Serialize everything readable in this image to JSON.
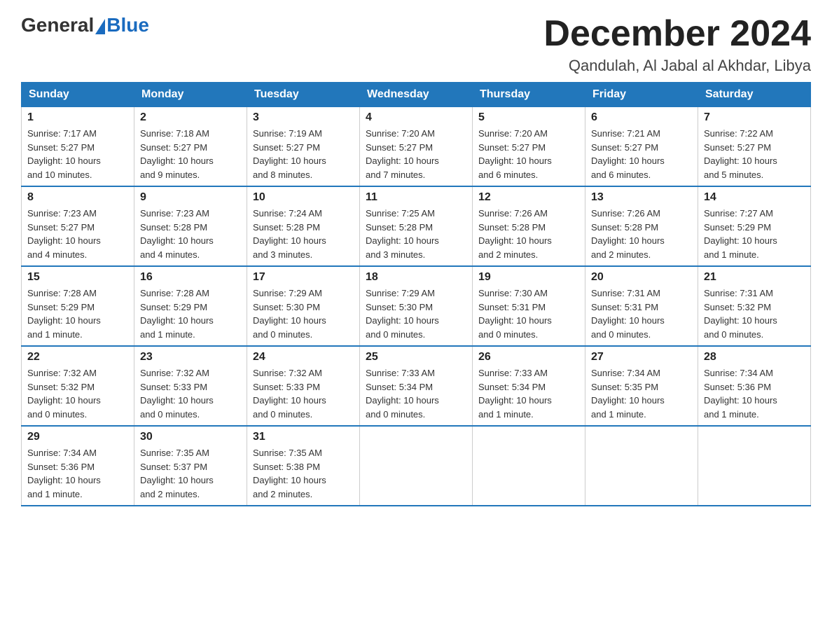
{
  "header": {
    "logo_general": "General",
    "logo_blue": "Blue",
    "month_year": "December 2024",
    "location": "Qandulah, Al Jabal al Akhdar, Libya"
  },
  "weekdays": [
    "Sunday",
    "Monday",
    "Tuesday",
    "Wednesday",
    "Thursday",
    "Friday",
    "Saturday"
  ],
  "weeks": [
    [
      {
        "day": "1",
        "sunrise": "7:17 AM",
        "sunset": "5:27 PM",
        "daylight": "10 hours and 10 minutes."
      },
      {
        "day": "2",
        "sunrise": "7:18 AM",
        "sunset": "5:27 PM",
        "daylight": "10 hours and 9 minutes."
      },
      {
        "day": "3",
        "sunrise": "7:19 AM",
        "sunset": "5:27 PM",
        "daylight": "10 hours and 8 minutes."
      },
      {
        "day": "4",
        "sunrise": "7:20 AM",
        "sunset": "5:27 PM",
        "daylight": "10 hours and 7 minutes."
      },
      {
        "day": "5",
        "sunrise": "7:20 AM",
        "sunset": "5:27 PM",
        "daylight": "10 hours and 6 minutes."
      },
      {
        "day": "6",
        "sunrise": "7:21 AM",
        "sunset": "5:27 PM",
        "daylight": "10 hours and 6 minutes."
      },
      {
        "day": "7",
        "sunrise": "7:22 AM",
        "sunset": "5:27 PM",
        "daylight": "10 hours and 5 minutes."
      }
    ],
    [
      {
        "day": "8",
        "sunrise": "7:23 AM",
        "sunset": "5:27 PM",
        "daylight": "10 hours and 4 minutes."
      },
      {
        "day": "9",
        "sunrise": "7:23 AM",
        "sunset": "5:28 PM",
        "daylight": "10 hours and 4 minutes."
      },
      {
        "day": "10",
        "sunrise": "7:24 AM",
        "sunset": "5:28 PM",
        "daylight": "10 hours and 3 minutes."
      },
      {
        "day": "11",
        "sunrise": "7:25 AM",
        "sunset": "5:28 PM",
        "daylight": "10 hours and 3 minutes."
      },
      {
        "day": "12",
        "sunrise": "7:26 AM",
        "sunset": "5:28 PM",
        "daylight": "10 hours and 2 minutes."
      },
      {
        "day": "13",
        "sunrise": "7:26 AM",
        "sunset": "5:28 PM",
        "daylight": "10 hours and 2 minutes."
      },
      {
        "day": "14",
        "sunrise": "7:27 AM",
        "sunset": "5:29 PM",
        "daylight": "10 hours and 1 minute."
      }
    ],
    [
      {
        "day": "15",
        "sunrise": "7:28 AM",
        "sunset": "5:29 PM",
        "daylight": "10 hours and 1 minute."
      },
      {
        "day": "16",
        "sunrise": "7:28 AM",
        "sunset": "5:29 PM",
        "daylight": "10 hours and 1 minute."
      },
      {
        "day": "17",
        "sunrise": "7:29 AM",
        "sunset": "5:30 PM",
        "daylight": "10 hours and 0 minutes."
      },
      {
        "day": "18",
        "sunrise": "7:29 AM",
        "sunset": "5:30 PM",
        "daylight": "10 hours and 0 minutes."
      },
      {
        "day": "19",
        "sunrise": "7:30 AM",
        "sunset": "5:31 PM",
        "daylight": "10 hours and 0 minutes."
      },
      {
        "day": "20",
        "sunrise": "7:31 AM",
        "sunset": "5:31 PM",
        "daylight": "10 hours and 0 minutes."
      },
      {
        "day": "21",
        "sunrise": "7:31 AM",
        "sunset": "5:32 PM",
        "daylight": "10 hours and 0 minutes."
      }
    ],
    [
      {
        "day": "22",
        "sunrise": "7:32 AM",
        "sunset": "5:32 PM",
        "daylight": "10 hours and 0 minutes."
      },
      {
        "day": "23",
        "sunrise": "7:32 AM",
        "sunset": "5:33 PM",
        "daylight": "10 hours and 0 minutes."
      },
      {
        "day": "24",
        "sunrise": "7:32 AM",
        "sunset": "5:33 PM",
        "daylight": "10 hours and 0 minutes."
      },
      {
        "day": "25",
        "sunrise": "7:33 AM",
        "sunset": "5:34 PM",
        "daylight": "10 hours and 0 minutes."
      },
      {
        "day": "26",
        "sunrise": "7:33 AM",
        "sunset": "5:34 PM",
        "daylight": "10 hours and 1 minute."
      },
      {
        "day": "27",
        "sunrise": "7:34 AM",
        "sunset": "5:35 PM",
        "daylight": "10 hours and 1 minute."
      },
      {
        "day": "28",
        "sunrise": "7:34 AM",
        "sunset": "5:36 PM",
        "daylight": "10 hours and 1 minute."
      }
    ],
    [
      {
        "day": "29",
        "sunrise": "7:34 AM",
        "sunset": "5:36 PM",
        "daylight": "10 hours and 1 minute."
      },
      {
        "day": "30",
        "sunrise": "7:35 AM",
        "sunset": "5:37 PM",
        "daylight": "10 hours and 2 minutes."
      },
      {
        "day": "31",
        "sunrise": "7:35 AM",
        "sunset": "5:38 PM",
        "daylight": "10 hours and 2 minutes."
      },
      null,
      null,
      null,
      null
    ]
  ],
  "labels": {
    "sunrise": "Sunrise:",
    "sunset": "Sunset:",
    "daylight": "Daylight:"
  }
}
